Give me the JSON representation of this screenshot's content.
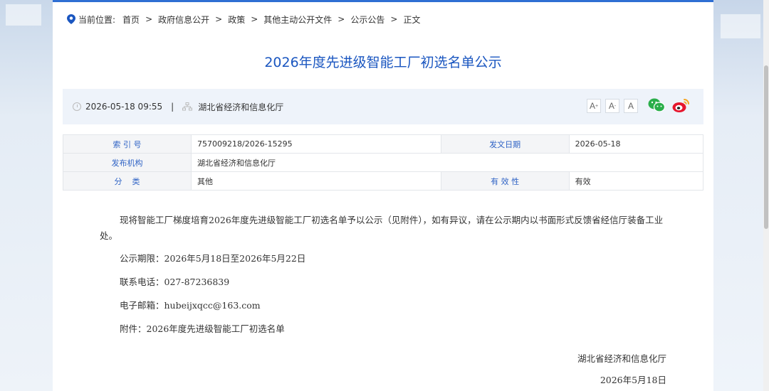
{
  "breadcrumb": {
    "label": "当前位置:",
    "items": [
      "首页",
      "政府信息公开",
      "政策",
      "其他主动公开文件",
      "公示公告",
      "正文"
    ],
    "separator": ">"
  },
  "title": "2026年度先进级智能工厂初选名单公示",
  "meta": {
    "datetime": "2026-05-18 09:55",
    "divider": "|",
    "publisher": "湖北省经济和信息化厅",
    "font_buttons": [
      "A",
      "A",
      "A"
    ]
  },
  "info_table": {
    "index_label": "索 引 号",
    "index_value": "757009218/2026-15295",
    "date_label": "发文日期",
    "date_value": "2026-05-18",
    "org_label": "发布机构",
    "org_value": "湖北省经济和信息化厅",
    "category_label": "分    类",
    "category_value": "其他",
    "validity_label": "有 效 性",
    "validity_value": "有效"
  },
  "content": {
    "paragraph": "现将智能工厂梯度培育2026年度先进级智能工厂初选名单予以公示（见附件），如有异议，请在公示期内以书面形式反馈省经信厅装备工业处。",
    "period": "公示期限：2026年5月18日至2026年5月22日",
    "phone": "联系电话：027-87236839",
    "email": "电子邮箱：hubeijxqcc@163.com",
    "attachment": "附件：2026年度先进级智能工厂初选名单"
  },
  "signature": {
    "org": "湖北省经济和信息化厅",
    "date": "2026年5月18日"
  },
  "colors": {
    "accent": "#1a56c0",
    "meta_bg": "#eef3fa",
    "wechat": "#2aae4a",
    "weibo": "#e6162d"
  }
}
